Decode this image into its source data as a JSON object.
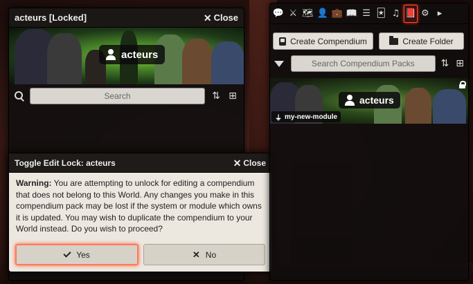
{
  "compendium_window": {
    "title": "acteurs [Locked]",
    "close_label": "Close",
    "banner_label": "acteurs",
    "search_placeholder": "Search"
  },
  "dialog": {
    "title": "Toggle Edit Lock: acteurs",
    "close_label": "Close",
    "warning_label": "Warning:",
    "message": " You are attempting to unlock for editing a compendium that does not belong to this World. Any changes you make in this compendium pack may be lost if the system or module which owns it is updated. You may wish to duplicate the compendium to your World instead. Do you wish to proceed?",
    "yes_label": "Yes",
    "no_label": "No"
  },
  "sidebar": {
    "tabs": [
      {
        "name": "chat-icon",
        "glyph": "💬"
      },
      {
        "name": "combat-icon",
        "glyph": "⚔"
      },
      {
        "name": "scenes-icon",
        "glyph": "🗺"
      },
      {
        "name": "actors-icon",
        "glyph": "👤"
      },
      {
        "name": "items-icon",
        "glyph": "💼"
      },
      {
        "name": "journal-icon",
        "glyph": "📖"
      },
      {
        "name": "tables-icon",
        "glyph": "☰"
      },
      {
        "name": "cards-icon",
        "glyph": "🃏"
      },
      {
        "name": "playlists-icon",
        "glyph": "♫"
      },
      {
        "name": "compendium-icon",
        "glyph": "📕"
      },
      {
        "name": "settings-icon",
        "glyph": "⚙"
      },
      {
        "name": "collapse-icon",
        "glyph": "▸"
      }
    ],
    "active_tab": "compendium-icon",
    "create_compendium_label": "Create Compendium",
    "create_folder_label": "Create Folder",
    "search_placeholder": "Search Compendium Packs",
    "pack": {
      "label": "acteurs",
      "module": "my-new-module"
    }
  },
  "colors": {
    "accent": "#ff4a2a",
    "dialog_bg": "#ece8e0"
  }
}
